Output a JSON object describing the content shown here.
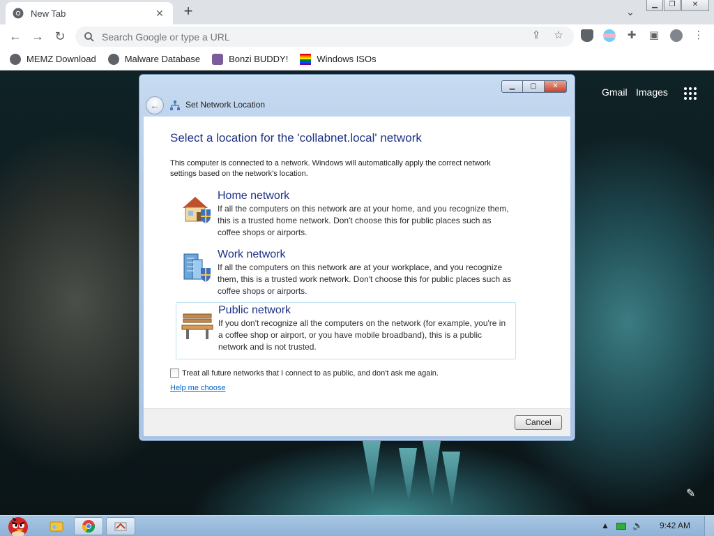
{
  "browser": {
    "tab_title": "New Tab",
    "tab_close": "✕",
    "new_tab": "+",
    "omnibox_placeholder": "Search Google or type a URL",
    "bookmarks": [
      {
        "label": "MEMZ Download",
        "icon": "globe-icon"
      },
      {
        "label": "Malware Database",
        "icon": "globe-icon"
      },
      {
        "label": "Bonzi BUDDY!",
        "icon": "bonzi-icon"
      },
      {
        "label": "Windows ISOs",
        "icon": "rainbow-flag-icon"
      }
    ]
  },
  "newtab_page": {
    "gmail_link": "Gmail",
    "images_link": "Images"
  },
  "dialog": {
    "title": "Set Network Location",
    "heading": "Select a location for the 'collabnet.local' network",
    "intro": "This computer is connected to a network. Windows will automatically apply the correct network settings based on the network's location.",
    "options": [
      {
        "title": "Home network",
        "description": "If all the computers on this network are at your home, and you recognize them, this is a trusted home network.  Don't choose this for public places such as coffee shops or airports.",
        "icon": "home-network-icon"
      },
      {
        "title": "Work network",
        "description": "If all the computers on this network are at your workplace, and you recognize them, this is a trusted work network.  Don't choose this for public places such as coffee shops or airports.",
        "icon": "work-network-icon"
      },
      {
        "title": "Public network",
        "description": "If you don't recognize all the computers on the network (for example, you're in a coffee shop or airport, or you have mobile broadband), this is a public network and is not trusted.",
        "icon": "public-network-bench-icon"
      }
    ],
    "checkbox_label": "Treat all future networks that I connect to as public, and don't ask me again.",
    "checkbox_checked": false,
    "help_link": "Help me choose",
    "cancel_label": "Cancel"
  },
  "taskbar": {
    "clock": "9:42 AM"
  },
  "colors": {
    "heading_blue": "#1e3287",
    "link_blue": "#0066cc",
    "taskbar": "#a8c6e3"
  }
}
